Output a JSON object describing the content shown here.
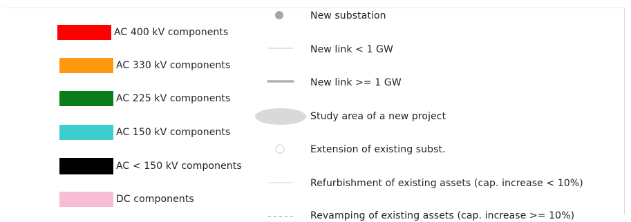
{
  "legend": {
    "voltage_items": [
      {
        "label": "AC 400 kV components",
        "color": "#ff0000"
      },
      {
        "label": "AC 330 kV components",
        "color": "#ff9a10"
      },
      {
        "label": "AC 225 kV components",
        "color": "#0a7d1a"
      },
      {
        "label": "AC 150 kV components",
        "color": "#3ecdcd"
      },
      {
        "label": "AC < 150 kV  components",
        "color": "#000000"
      },
      {
        "label": "DC components",
        "color": "#f8bcd6"
      }
    ],
    "symbol_items": [
      {
        "label": "New substation",
        "icon": "filled-gray-dot-icon"
      },
      {
        "label": "New link < 1 GW",
        "icon": "thin-gray-line-icon"
      },
      {
        "label": "New link >= 1 GW",
        "icon": "thick-gray-line-icon"
      },
      {
        "label": "Study area of a new project",
        "icon": "gray-ellipse-icon"
      },
      {
        "label": "Extension of existing subst.",
        "icon": "hollow-circle-icon"
      },
      {
        "label": "Refurbishment of existing  assets (cap. increase < 10%)",
        "icon": "thin-light-line-icon"
      },
      {
        "label": "Revamping of existing assets (cap. increase >= 10%)",
        "icon": "dashed-line-icon"
      }
    ]
  }
}
